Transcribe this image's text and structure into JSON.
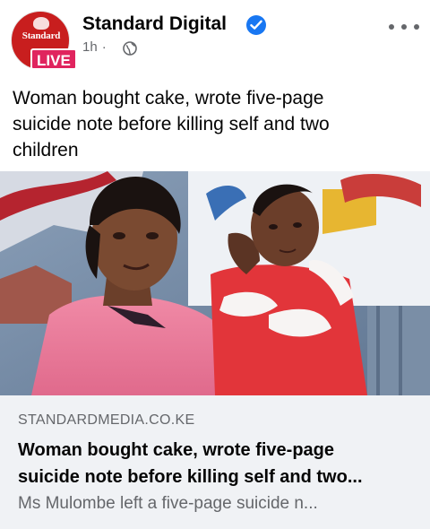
{
  "post": {
    "page_name": "Standard Digital",
    "avatar_brand": "Standard",
    "live_label": "LIVE",
    "time": "1h",
    "separator": "·",
    "audience_icon": "globe-icon",
    "verified_icon": "verified-check-icon",
    "more_icon": "more-options-icon",
    "text_lines": [
      "Woman bought cake, wrote five-page",
      "suicide note before killing self and two",
      "children"
    ]
  },
  "link_preview": {
    "domain": "STANDARDMEDIA.CO.KE",
    "title_lines": [
      "Woman bought cake, wrote five-page",
      "suicide note before killing self and two..."
    ],
    "description": "Ms Mulombe left a five-page suicide n..."
  },
  "colors": {
    "verified": "#1877f2",
    "live": "#e0245e",
    "avatar": "#c81e1e",
    "card_bg": "#f0f2f5",
    "secondary_text": "#65676b"
  }
}
